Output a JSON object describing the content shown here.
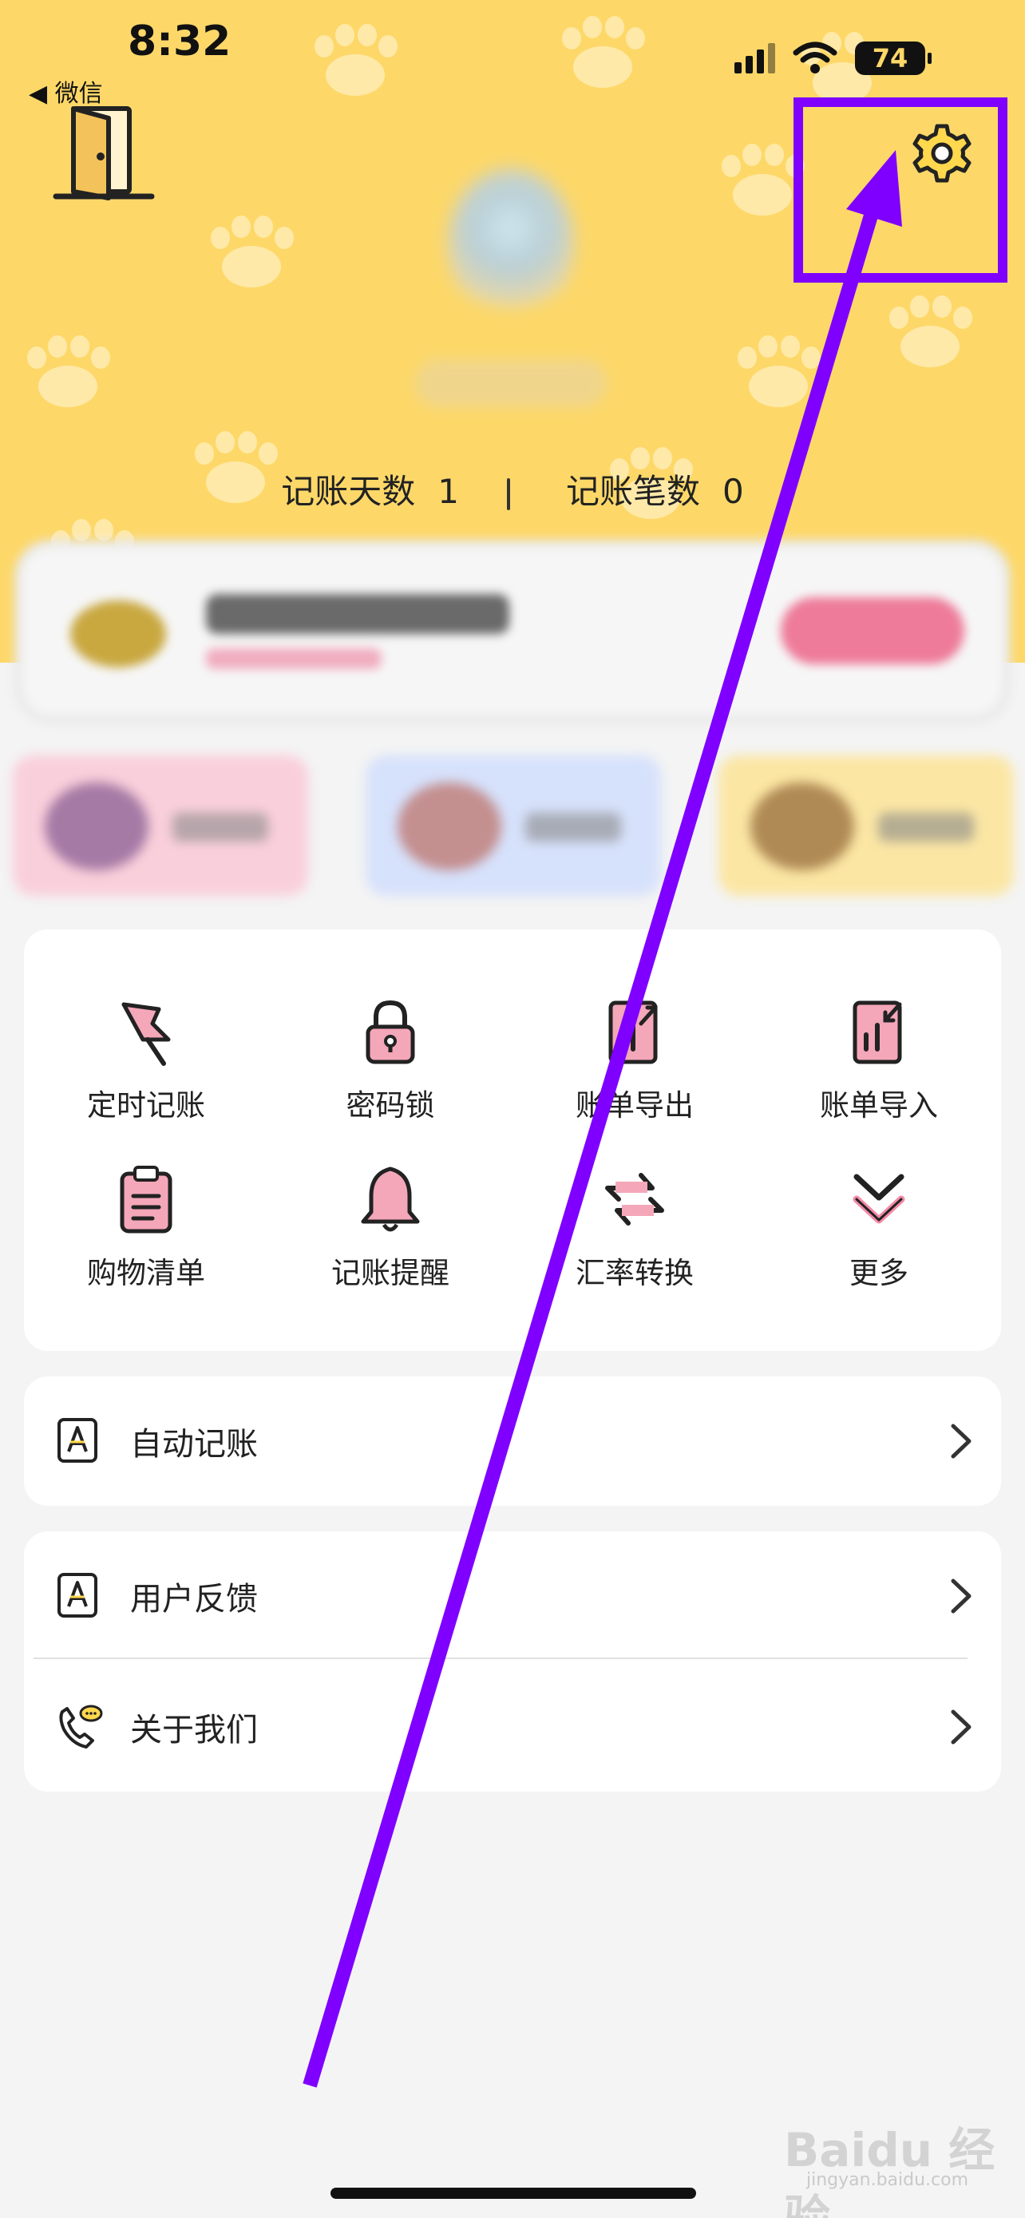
{
  "status_bar": {
    "time": "8:32",
    "back_label": "◀ 微信",
    "battery": "74"
  },
  "stats": {
    "days_label": "记账天数",
    "days_value": "1",
    "records_label": "记账笔数",
    "records_value": "0"
  },
  "functions": [
    {
      "label": "定时记账",
      "icon": "pushpin-icon"
    },
    {
      "label": "密码锁",
      "icon": "padlock-icon"
    },
    {
      "label": "账单导出",
      "icon": "bill-export-icon"
    },
    {
      "label": "账单导入",
      "icon": "bill-import-icon"
    },
    {
      "label": "购物清单",
      "icon": "clipboard-icon"
    },
    {
      "label": "记账提醒",
      "icon": "bell-icon"
    },
    {
      "label": "汇率转换",
      "icon": "exchange-arrows-icon"
    },
    {
      "label": "更多",
      "icon": "double-chevron-down-icon"
    }
  ],
  "list": {
    "auto_record": "自动记账",
    "feedback": "用户反馈",
    "about": "关于我们",
    "chevron": ">"
  },
  "watermark": {
    "brand": "Baidu 经验",
    "site": "jingyan.baidu.com"
  },
  "colors": {
    "header_yellow": "#fdd869",
    "annotation_purple": "#7f00ff",
    "icon_pink": "#f4a7b9"
  }
}
